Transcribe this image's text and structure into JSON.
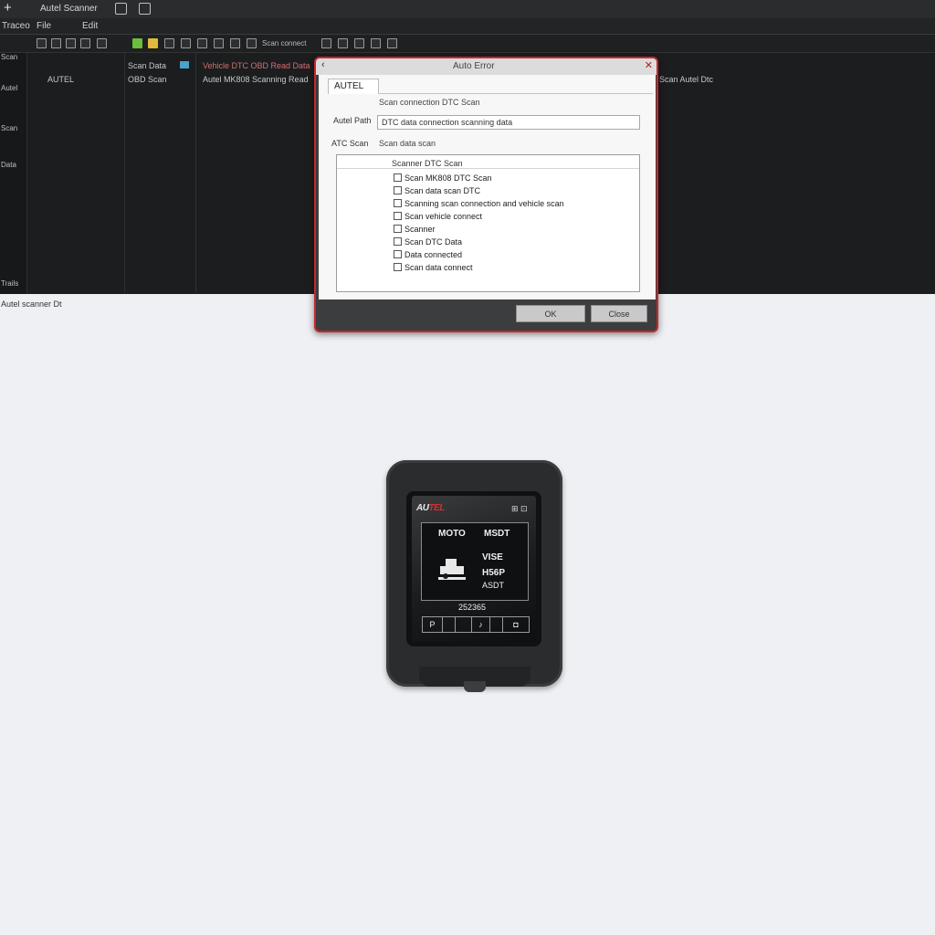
{
  "window": {
    "title": "Autel Scanner",
    "new_label": "+"
  },
  "menu": [
    "Traceo",
    "File",
    "Edit"
  ],
  "toolbar": {
    "mid_label": "Scan connect"
  },
  "left_rail": [
    "Scan",
    "Autel",
    "Scan",
    "Data",
    "Trails"
  ],
  "grid": {
    "r1c1": "Scan Data",
    "r1c2": "Vehicle DTC OBD Read Data",
    "r2c0": "AUTEL",
    "r2c1": "OBD Scan",
    "r2c2": "Autel MK808 Scanning Read",
    "r2c3": "Scan Autel Dtc"
  },
  "status": {
    "text": "Autel scanner Dt"
  },
  "dialog": {
    "title": "Auto Error",
    "tab": "AUTEL",
    "row1_value": "Scan connection DTC Scan",
    "row2_label": "Autel Path",
    "row2_input": "DTC data connection scanning data",
    "row3_label": "ATC Scan",
    "row3_value": "Scan data scan",
    "list_header": "Scanner DTC Scan",
    "checks": [
      {
        "label": "Scan MK808 DTC Scan",
        "checked": false
      },
      {
        "label": "Scan data scan DTC",
        "checked": false
      },
      {
        "label": "Scanning scan connection and vehicle scan",
        "checked": false
      },
      {
        "label": "Scan vehicle connect",
        "checked": false
      },
      {
        "label": "Scanner",
        "checked": false
      },
      {
        "label": "Scan DTC Data",
        "checked": false
      },
      {
        "label": "Data connected",
        "checked": false
      },
      {
        "label": "Scan data connect",
        "checked": false
      }
    ],
    "ok_label": "OK",
    "cancel_label": "Close"
  },
  "device": {
    "brand_a": "AU",
    "brand_b": "TEL",
    "top_icons": "⊞ ⊡",
    "line_left": "MOTO",
    "line_right": "MSDT",
    "mid_right_a": "VISE",
    "mid_right_b": "H56P",
    "mid_right_c": "ASDT",
    "code": "252365",
    "bar_cells": [
      "P",
      "",
      "",
      "♪",
      "",
      "◘"
    ]
  }
}
